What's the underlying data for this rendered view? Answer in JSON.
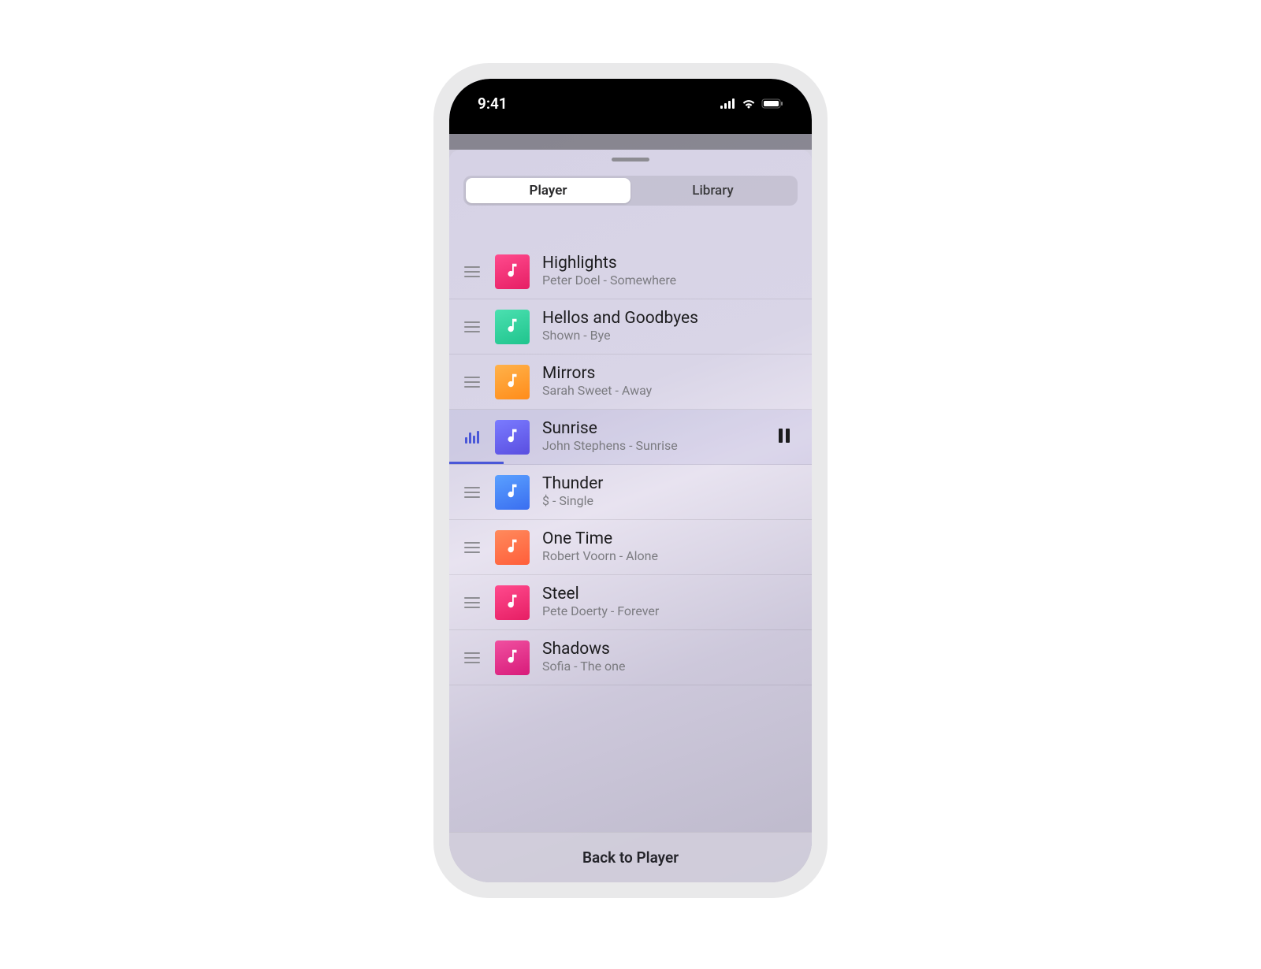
{
  "status": {
    "time": "9:41"
  },
  "tabs": {
    "player": "Player",
    "library": "Library",
    "activeIndex": 0
  },
  "tracks": [
    {
      "title": "Highlights",
      "subtitle": "Peter Doel - Somewhere",
      "art": "pink",
      "playing": false
    },
    {
      "title": "Hellos and Goodbyes",
      "subtitle": "Shown - Bye",
      "art": "teal",
      "playing": false
    },
    {
      "title": "Mirrors",
      "subtitle": "Sarah Sweet - Away",
      "art": "orange",
      "playing": false
    },
    {
      "title": "Sunrise",
      "subtitle": "John Stephens - Sunrise",
      "art": "indigo",
      "playing": true,
      "progressPercent": 15
    },
    {
      "title": "Thunder",
      "subtitle": "$ - Single",
      "art": "blue",
      "playing": false
    },
    {
      "title": "One Time",
      "subtitle": "Robert Voorn - Alone",
      "art": "coral",
      "playing": false
    },
    {
      "title": "Steel",
      "subtitle": "Pete Doerty - Forever",
      "art": "pink",
      "playing": false
    },
    {
      "title": "Shadows",
      "subtitle": "Sofia - The one",
      "art": "magenta",
      "playing": false
    }
  ],
  "artColors": {
    "pink": "linear-gradient(160deg,#ff4a8d,#e61e64)",
    "teal": "linear-gradient(160deg,#4be0b0,#1fc48d)",
    "orange": "linear-gradient(160deg,#ffb24a,#ff8c1a)",
    "indigo": "linear-gradient(160deg,#7a7bff,#5a4ee0)",
    "blue": "linear-gradient(160deg,#5aa0ff,#3a6ef0)",
    "coral": "linear-gradient(160deg,#ff8a5c,#ff5e3a)",
    "magenta": "linear-gradient(160deg,#f050a0,#d81b7a)"
  },
  "footer": {
    "label": "Back to Player"
  }
}
